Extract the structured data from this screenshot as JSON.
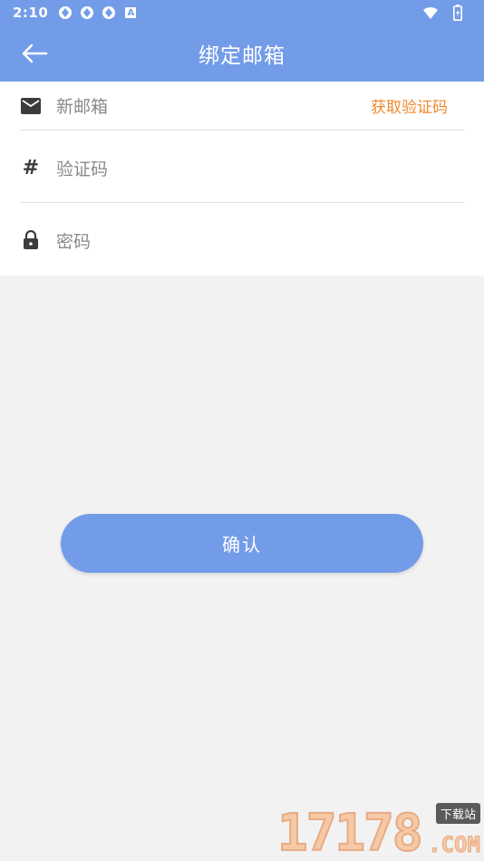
{
  "statusbar": {
    "time": "2:10",
    "left_icons": [
      "aperture-icon",
      "aperture-icon",
      "aperture-icon",
      "text-a-icon"
    ],
    "right_icons": [
      "wifi-icon",
      "battery-icon"
    ],
    "a_glyph": "A"
  },
  "appbar": {
    "title": "绑定邮箱",
    "back_icon": "arrow-left-icon"
  },
  "form": {
    "email": {
      "placeholder": "新邮箱",
      "icon": "mail-icon",
      "action_label": "获取验证码"
    },
    "code": {
      "placeholder": "验证码",
      "icon": "hash-icon",
      "glyph": "#"
    },
    "password": {
      "placeholder": "密码",
      "icon": "lock-icon"
    }
  },
  "confirm_label": "确认",
  "watermark": {
    "number": "17178",
    "site": "下载站",
    "com": ".COM"
  },
  "colors": {
    "primary": "#739ce8",
    "accent": "#f0882c",
    "background": "#f2f2f2"
  }
}
